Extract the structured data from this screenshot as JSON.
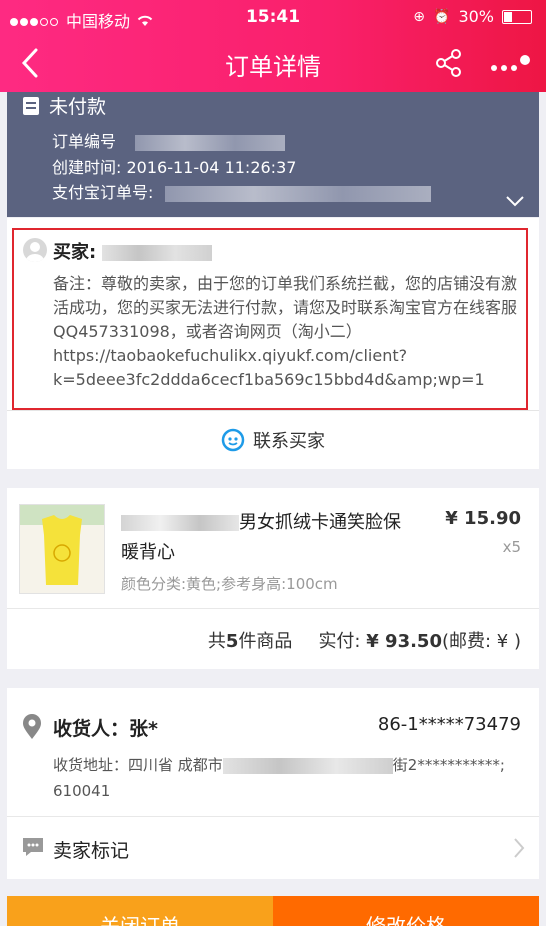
{
  "status_bar": {
    "carrier": "中国移动",
    "time": "15:41",
    "battery": "30%"
  },
  "header": {
    "title": "订单详情"
  },
  "order": {
    "status": "未付款",
    "order_no_label": "订单编号",
    "created_label": "创建时间:",
    "created_value": "2016-11-04 11:26:37",
    "alipay_label": "支付宝订单号:"
  },
  "buyer": {
    "label": "买家:",
    "note": "备注：尊敬的卖家，由于您的订单我们系统拦截，您的店铺没有激活成功，您的买家无法进行付款，请您及时联系淘宝官方在线客服QQ457331098，或者咨询网页（淘小二）\nhttps://taobaokefuchulikx.qiyukf.com/client?k=5deee3fc2ddda6cecf1ba569c15bbd4d&amp;wp=1"
  },
  "contact": {
    "label": "联系买家"
  },
  "product": {
    "name": "男女抓绒卡通笑脸保暖背心",
    "attrs": "颜色分类:黄色;参考身高:100cm",
    "price": "¥ 15.90",
    "qty": "x5"
  },
  "summary": {
    "count_prefix": "共",
    "count": "5",
    "count_suffix": "件商品",
    "paid_label": "实付:",
    "paid_value": "¥ 93.50",
    "postage": "(邮费: ¥ )"
  },
  "address": {
    "receiver": "收货人：张*",
    "phone": "86-1*****73479",
    "addr_prefix": "收货地址：四川省 成都市",
    "addr_suffix": "街2***********;",
    "zip": "610041"
  },
  "seller_mark": {
    "label": "卖家标记"
  },
  "actions": {
    "close_label": "关闭订单",
    "modify_label": "修改价格"
  },
  "colors": {
    "brand_pink": "#fe2a82",
    "order_header_bg": "#5b6380",
    "highlight_red": "#e0262f",
    "button_orange": "#f9a11b",
    "button_deep_orange": "#ff6a00"
  }
}
